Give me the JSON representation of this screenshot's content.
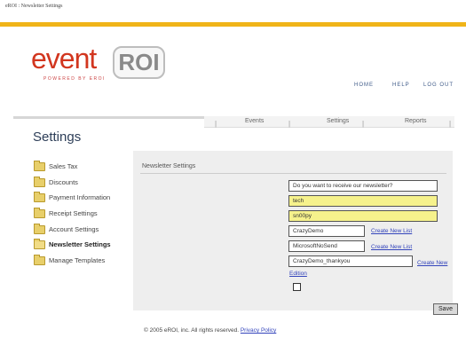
{
  "window": {
    "title": "eROI : Newsletter Settings"
  },
  "brand": {
    "accent": "#f0b418",
    "event_text": "event",
    "roi_text": "ROI",
    "powered_text": "POWERED BY EROI"
  },
  "header_links": [
    {
      "label": "HOME"
    },
    {
      "label": "HELP"
    },
    {
      "label": "LOG OUT"
    }
  ],
  "tabs": [
    {
      "label": "Events"
    },
    {
      "label": "Settings"
    },
    {
      "label": "Reports"
    }
  ],
  "page": {
    "title": "Settings"
  },
  "sidebar": {
    "items": [
      {
        "label": "Sales Tax",
        "icon": "folder-icon"
      },
      {
        "label": "Discounts",
        "icon": "folder-icon"
      },
      {
        "label": "Payment Information",
        "icon": "folder-icon"
      },
      {
        "label": "Receipt Settings",
        "icon": "folder-icon"
      },
      {
        "label": "Account Settings",
        "icon": "folder-icon"
      },
      {
        "label": "Newsletter Settings",
        "icon": "folder-open-icon",
        "active": true
      },
      {
        "label": "Manage Templates",
        "icon": "folder-icon"
      }
    ]
  },
  "newsletter": {
    "heading": "Newsletter Settings",
    "question_field": "Do you want to receive our newsletter?",
    "username": "tech",
    "password": "sn00py",
    "list1": "CrazyDemo",
    "list2": "MicrosoftNoSend",
    "edition": "CrazyDemo_thankyou",
    "create_list_label": "Create New List",
    "create_edition_label": "Create New",
    "create_edition_label_wrap": "Edition",
    "save_label": "Save"
  },
  "footer": {
    "copyright": "© 2005 eROI, inc. All rights reserved.",
    "privacy_label": "Privacy Policy"
  }
}
